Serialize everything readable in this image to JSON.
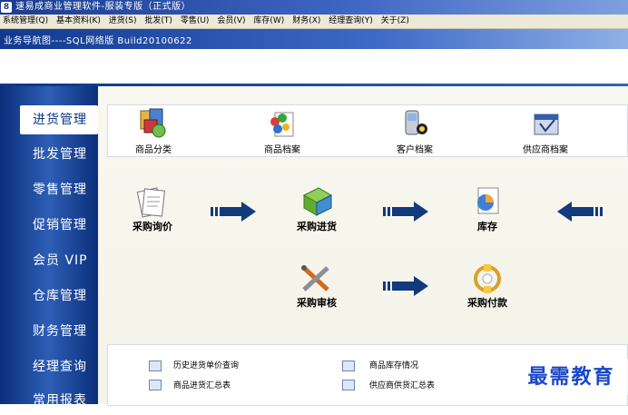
{
  "window": {
    "title": "速易成商业管理软件-服装专版（正式版）"
  },
  "menu": [
    "系统管理(Q)",
    "基本资料(K)",
    "进货(S)",
    "批发(T)",
    "零售(U)",
    "会员(V)",
    "库存(W)",
    "财务(X)",
    "经理查询(Y)",
    "关于(Z)"
  ],
  "nav": {
    "text": "业务导航图----SQL网络版 Build20100622"
  },
  "sidebar": {
    "items": [
      "进货管理",
      "批发管理",
      "零售管理",
      "促销管理",
      "会员 VIP",
      "仓库管理",
      "财务管理",
      "经理查询",
      "常用报表"
    ],
    "active_index": 0
  },
  "toprow": {
    "items": [
      {
        "label": "商品分类",
        "icon": "categories-icon"
      },
      {
        "label": "商品档案",
        "icon": "product-archive-icon"
      },
      {
        "label": "客户档案",
        "icon": "customer-archive-icon"
      },
      {
        "label": "供应商档案",
        "icon": "supplier-archive-icon"
      }
    ]
  },
  "flow": {
    "inquiry": "采购询价",
    "purchase": "采购进货",
    "inventory": "库存",
    "review": "采购审核",
    "payment": "采购付款"
  },
  "bottom": {
    "links": [
      "历史进货单价查询",
      "商品库存情况",
      "商品进货汇总表",
      "供应商供货汇总表"
    ]
  },
  "watermark": "最需教育",
  "colors": {
    "accent": "#0b3886",
    "arrow": "#123a7c",
    "watermark": "#1a47c8"
  }
}
